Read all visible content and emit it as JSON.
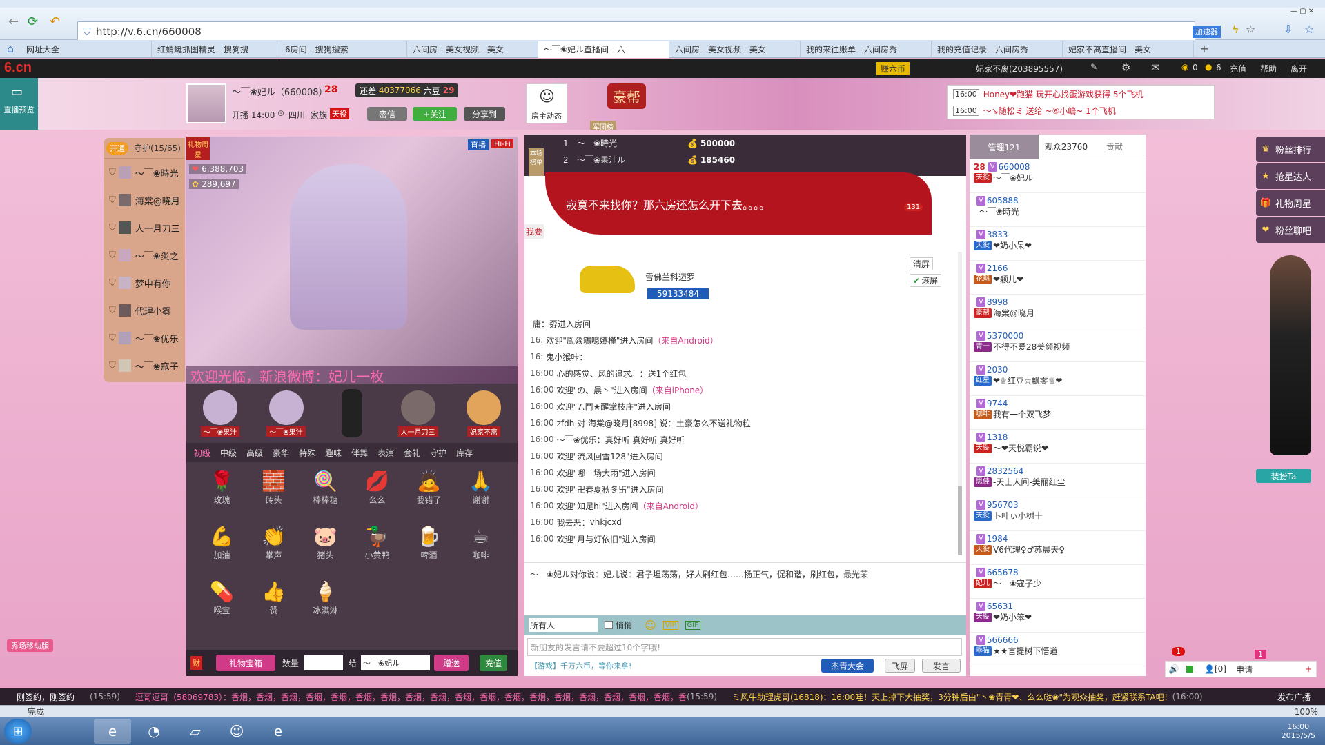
{
  "browser": {
    "url": "http://v.6.cn/660008",
    "speed_label": "加速器",
    "tabs": [
      {
        "label": "网址大全"
      },
      {
        "label": "红蜻蜓抓图精灵 - 搜狗搜"
      },
      {
        "label": "6房间 - 搜狗搜索"
      },
      {
        "label": "六间房 - 美女视频 - 美女"
      },
      {
        "label": "〜￣❀妃ル直播间 - 六"
      },
      {
        "label": "六间房 - 美女视频 - 美女"
      },
      {
        "label": "我的来往账单 - 六间房秀"
      },
      {
        "label": "我的充值记录 - 六间房秀"
      },
      {
        "label": "妃家不离直播间 - 美女"
      }
    ]
  },
  "site": {
    "logo": "6.cn",
    "coin_label": "赚六币",
    "user": "妃家不离(203895557)",
    "coins": "0",
    "beans": "6",
    "recharge": "充值",
    "help": "帮助",
    "leave": "离开",
    "preview_label": "直播预览"
  },
  "anchor": {
    "name": "〜￣❀妃ル（660008）",
    "level": "28",
    "need_label": "还差",
    "need_value": "40377066",
    "level_next_label": "六豆",
    "level_next": "29",
    "start_time": "开播 14:00",
    "location": "四川",
    "family_label": "家族",
    "family": "天役",
    "msg_btn": "密信",
    "follow_btn": "+关注",
    "share_btn": "分享到",
    "owner_label": "房主动态",
    "haobang": "豪帮",
    "army": "军团榜"
  },
  "notices": [
    {
      "time": "16:00",
      "text": "Honey❤跑猫 玩开心找蛋游戏获得 5个飞机"
    },
    {
      "time": "16:00",
      "text": "〜↘随松ミ 送给 ~⑥小嶋~ 1个飞机"
    }
  ],
  "guard": {
    "open_label": "开通",
    "title": "守护(15/65)",
    "members": [
      "〜￣❀時光",
      "海棠@晓月",
      "人一月刀三",
      "〜￣❀炎之",
      "梦中有你",
      "代理小雾",
      "〜￣❀优乐",
      "〜￣❀寇子"
    ]
  },
  "video": {
    "gift_week": "礼物周星",
    "stat1": "6,388,703",
    "stat2": "289,697",
    "live_tag": "直播",
    "hifi_tag": "Hi-Fi",
    "scroll_text": "欢迎光临，新浪微博：妃儿一枚"
  },
  "seats": [
    "〜￣❀果汁",
    "〜￣❀果汁",
    "",
    "人一月刀三",
    "妃家不离"
  ],
  "gift_tabs": [
    "初级",
    "中级",
    "高级",
    "豪华",
    "特殊",
    "趣味",
    "伴舞",
    "表演",
    "套礼",
    "守护",
    "库存"
  ],
  "gifts": [
    {
      "name": "玫瑰",
      "icon": "🌹"
    },
    {
      "name": "砖头",
      "icon": "🧱"
    },
    {
      "name": "棒棒糖",
      "icon": "🍭"
    },
    {
      "name": "么么",
      "icon": "💋"
    },
    {
      "name": "我错了",
      "icon": "🙇"
    },
    {
      "name": "谢谢",
      "icon": "🙏"
    },
    {
      "name": "加油",
      "icon": "💪"
    },
    {
      "name": "掌声",
      "icon": "👏"
    },
    {
      "name": "猪头",
      "icon": "🐷"
    },
    {
      "name": "小黄鸭",
      "icon": "🦆"
    },
    {
      "name": "啤酒",
      "icon": "🍺"
    },
    {
      "name": "咖啡",
      "icon": "☕"
    },
    {
      "name": "喉宝",
      "icon": "💊"
    },
    {
      "name": "赞",
      "icon": "👍"
    },
    {
      "name": "冰淇淋",
      "icon": "🍦"
    }
  ],
  "gift_bar": {
    "treasure": "礼物宝箱",
    "qty_label": "数量",
    "to_label": "给",
    "to_value": "〜￣❀妃ル",
    "send": "赠送",
    "recharge": "充值"
  },
  "rank": [
    {
      "no": "1",
      "name": "〜￣❀時光",
      "value": "500000"
    },
    {
      "no": "2",
      "name": "〜￣❀果汁ル",
      "value": "185460"
    }
  ],
  "rank_tab": "本场榜单",
  "banner_text": "寂寞不来找你？那六房还怎么开下去。。。。",
  "car_count": "131",
  "side_tab": "我要",
  "chat_controls": {
    "clear": "清屏",
    "scroll": "滚屏"
  },
  "car": {
    "brand": "雪佛兰科迈罗",
    "id": "59133484"
  },
  "chat": [
    {
      "time": "",
      "pre": "",
      "name": "庸：孬",
      "post": "进入房间",
      "src": ""
    },
    {
      "time": "16:",
      "pre": "欢迎",
      "name": "\"鳯燚鵴噫嬿槿\"",
      "post": "进入房间",
      "src": "（来自Android）"
    },
    {
      "time": "16:",
      "pre": "",
      "name": "鬼小猴咔：",
      "post": "",
      "src": ""
    },
    {
      "time": "16:00",
      "pre": "",
      "name": "心的感觉、风的追求。",
      "post": "：送1个红包",
      "src": ""
    },
    {
      "time": "16:00",
      "pre": "欢迎",
      "name": "\"の、晨丶\"",
      "post": "进入房间",
      "src": "（来自iPhone）"
    },
    {
      "time": "16:00",
      "pre": "欢迎",
      "name": "\"7.鬥★醒掌枝庄\"",
      "post": "进入房间",
      "src": ""
    },
    {
      "time": "16:00",
      "pre": "",
      "name": "zfdh 对 海棠@晓月[8998] 说：",
      "post": "土豪怎么不送礼物粒",
      "src": ""
    },
    {
      "time": "16:00",
      "pre": "",
      "name": "〜￣❀优乐：",
      "post": "真好听 真好听 真好听",
      "src": ""
    },
    {
      "time": "16:00",
      "pre": "欢迎",
      "name": "\"流风回雪128\"",
      "post": "进入房间",
      "src": ""
    },
    {
      "time": "16:00",
      "pre": "欢迎",
      "name": "\"哪一场大雨\"",
      "post": "进入房间",
      "src": ""
    },
    {
      "time": "16:00",
      "pre": "欢迎",
      "name": "\"卍春夏秋冬卐\"",
      "post": "进入房间",
      "src": ""
    },
    {
      "time": "16:00",
      "pre": "欢迎",
      "name": "\"知足hi\"",
      "post": "进入房间",
      "src": "（来自Android）"
    },
    {
      "time": "16:00",
      "pre": "",
      "name": "我去恶：",
      "post": "vhkjcxd",
      "src": ""
    },
    {
      "time": "16:00",
      "pre": "欢迎",
      "name": "\"月与灯依旧\"",
      "post": "进入房间",
      "src": ""
    }
  ],
  "private_msg": "〜￣❀妃ル对你说：妃儿说：君子坦荡荡，好人刷红包……扬正气，促和谐，刷红包，最光荣",
  "chat_input": {
    "target": "所有人",
    "whisper": "悄悄",
    "placeholder": "新朋友的发言请不要超过10个字哦!",
    "game_tip": "【游戏】千万六币，等你来拿!",
    "btn_jiejie": "杰青大会",
    "btn_fly": "飞屏",
    "btn_send": "发言"
  },
  "users_tabs": {
    "admin": "管理121",
    "audience": "观众23760",
    "contrib": "贡献"
  },
  "users": [
    {
      "level": "28",
      "id": "660008",
      "tag": "天役",
      "name": "〜￣❀妃ル"
    },
    {
      "level": "",
      "id": "605888",
      "tag": "",
      "name": "〜￣❀時光"
    },
    {
      "level": "",
      "id": "3833",
      "tag": "天役",
      "name": "❤奶小呆❤"
    },
    {
      "level": "",
      "id": "2166",
      "tag": "花魁",
      "name": "❤颖儿❤"
    },
    {
      "level": "",
      "id": "8998",
      "tag": "豪帮",
      "name": "海棠@晓月"
    },
    {
      "level": "",
      "id": "5370000",
      "tag": "青一",
      "name": "不得不爱28美颜视频"
    },
    {
      "level": "",
      "id": "2030",
      "tag": "红星",
      "name": "❤♕红豆☆飘零♕❤"
    },
    {
      "level": "",
      "id": "9744",
      "tag": "咖啡",
      "name": "我有一个双飞梦"
    },
    {
      "level": "",
      "id": "1318",
      "tag": "天役",
      "name": "〜❤天悦霸说❤"
    },
    {
      "level": "",
      "id": "2832564",
      "tag": "思佳",
      "name": "-天上人间-美丽红尘"
    },
    {
      "level": "",
      "id": "956703",
      "tag": "天役",
      "name": "卜叶ぃ小树十"
    },
    {
      "level": "",
      "id": "1984",
      "tag": "天役",
      "name": "V6代理♀♂苏晨天♀"
    },
    {
      "level": "",
      "id": "665678",
      "tag": "妃儿",
      "name": "〜￣❀寇子少"
    },
    {
      "level": "",
      "id": "65631",
      "tag": "天役",
      "name": "❤奶小笨❤"
    },
    {
      "level": "",
      "id": "566666",
      "tag": "乖猫",
      "name": "★★言提树下悟道"
    }
  ],
  "side_buttons": [
    "粉丝排行",
    "抢星达人",
    "礼物周星",
    "粉丝聊吧"
  ],
  "dress_btn": "装扮Ta",
  "mobile_live": "秀场移动版",
  "mic": {
    "badge1": "1",
    "badge2": "1",
    "count": "[0]",
    "apply": "申请"
  },
  "ticker": {
    "left": "刚签约，刚签约",
    "time1": "(15:59)",
    "msg1": "逗哥逗哥（58069783）：香烟，香烟，香烟，香烟，香烟，香烟，香烟，香烟，香烟，香烟，香烟，香烟，香烟，香烟，香烟，香烟，香烟，香烟，香",
    "time2": "(15:59)",
    "msg2": "ミ风牛助理虎哥(16818)：16:00哇！天上掉下大抽奖，3分钟后由\"丶❀青青❤、么么哒❀\"为观众抽奖，赶紧联系TA吧！",
    "time3": "(16:00)",
    "publish": "发布广播"
  },
  "status": {
    "done": "完成",
    "zoom": "100%"
  },
  "taskbar": {
    "time": "16:00",
    "date": "2015/5/5"
  }
}
